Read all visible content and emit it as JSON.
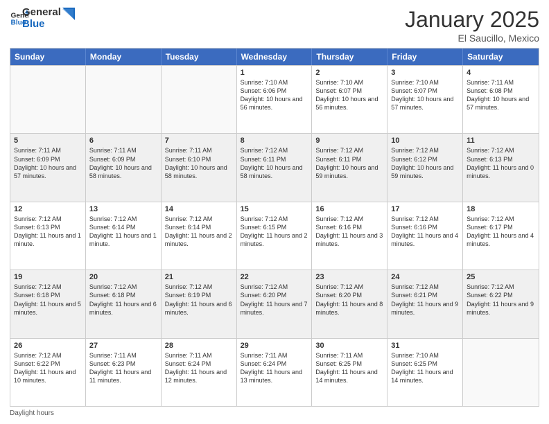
{
  "header": {
    "logo_general": "General",
    "logo_blue": "Blue",
    "month_title": "January 2025",
    "subtitle": "El Saucillo, Mexico"
  },
  "footer": {
    "label": "Daylight hours"
  },
  "days_of_week": [
    "Sunday",
    "Monday",
    "Tuesday",
    "Wednesday",
    "Thursday",
    "Friday",
    "Saturday"
  ],
  "rows": [
    [
      {
        "num": "",
        "info": "",
        "empty": true
      },
      {
        "num": "",
        "info": "",
        "empty": true
      },
      {
        "num": "",
        "info": "",
        "empty": true
      },
      {
        "num": "1",
        "info": "Sunrise: 7:10 AM\nSunset: 6:06 PM\nDaylight: 10 hours and 56 minutes."
      },
      {
        "num": "2",
        "info": "Sunrise: 7:10 AM\nSunset: 6:07 PM\nDaylight: 10 hours and 56 minutes."
      },
      {
        "num": "3",
        "info": "Sunrise: 7:10 AM\nSunset: 6:07 PM\nDaylight: 10 hours and 57 minutes."
      },
      {
        "num": "4",
        "info": "Sunrise: 7:11 AM\nSunset: 6:08 PM\nDaylight: 10 hours and 57 minutes."
      }
    ],
    [
      {
        "num": "5",
        "info": "Sunrise: 7:11 AM\nSunset: 6:09 PM\nDaylight: 10 hours and 57 minutes."
      },
      {
        "num": "6",
        "info": "Sunrise: 7:11 AM\nSunset: 6:09 PM\nDaylight: 10 hours and 58 minutes."
      },
      {
        "num": "7",
        "info": "Sunrise: 7:11 AM\nSunset: 6:10 PM\nDaylight: 10 hours and 58 minutes."
      },
      {
        "num": "8",
        "info": "Sunrise: 7:12 AM\nSunset: 6:11 PM\nDaylight: 10 hours and 58 minutes."
      },
      {
        "num": "9",
        "info": "Sunrise: 7:12 AM\nSunset: 6:11 PM\nDaylight: 10 hours and 59 minutes."
      },
      {
        "num": "10",
        "info": "Sunrise: 7:12 AM\nSunset: 6:12 PM\nDaylight: 10 hours and 59 minutes."
      },
      {
        "num": "11",
        "info": "Sunrise: 7:12 AM\nSunset: 6:13 PM\nDaylight: 11 hours and 0 minutes."
      }
    ],
    [
      {
        "num": "12",
        "info": "Sunrise: 7:12 AM\nSunset: 6:13 PM\nDaylight: 11 hours and 1 minute."
      },
      {
        "num": "13",
        "info": "Sunrise: 7:12 AM\nSunset: 6:14 PM\nDaylight: 11 hours and 1 minute."
      },
      {
        "num": "14",
        "info": "Sunrise: 7:12 AM\nSunset: 6:14 PM\nDaylight: 11 hours and 2 minutes."
      },
      {
        "num": "15",
        "info": "Sunrise: 7:12 AM\nSunset: 6:15 PM\nDaylight: 11 hours and 2 minutes."
      },
      {
        "num": "16",
        "info": "Sunrise: 7:12 AM\nSunset: 6:16 PM\nDaylight: 11 hours and 3 minutes."
      },
      {
        "num": "17",
        "info": "Sunrise: 7:12 AM\nSunset: 6:16 PM\nDaylight: 11 hours and 4 minutes."
      },
      {
        "num": "18",
        "info": "Sunrise: 7:12 AM\nSunset: 6:17 PM\nDaylight: 11 hours and 4 minutes."
      }
    ],
    [
      {
        "num": "19",
        "info": "Sunrise: 7:12 AM\nSunset: 6:18 PM\nDaylight: 11 hours and 5 minutes."
      },
      {
        "num": "20",
        "info": "Sunrise: 7:12 AM\nSunset: 6:18 PM\nDaylight: 11 hours and 6 minutes."
      },
      {
        "num": "21",
        "info": "Sunrise: 7:12 AM\nSunset: 6:19 PM\nDaylight: 11 hours and 6 minutes."
      },
      {
        "num": "22",
        "info": "Sunrise: 7:12 AM\nSunset: 6:20 PM\nDaylight: 11 hours and 7 minutes."
      },
      {
        "num": "23",
        "info": "Sunrise: 7:12 AM\nSunset: 6:20 PM\nDaylight: 11 hours and 8 minutes."
      },
      {
        "num": "24",
        "info": "Sunrise: 7:12 AM\nSunset: 6:21 PM\nDaylight: 11 hours and 9 minutes."
      },
      {
        "num": "25",
        "info": "Sunrise: 7:12 AM\nSunset: 6:22 PM\nDaylight: 11 hours and 9 minutes."
      }
    ],
    [
      {
        "num": "26",
        "info": "Sunrise: 7:12 AM\nSunset: 6:22 PM\nDaylight: 11 hours and 10 minutes."
      },
      {
        "num": "27",
        "info": "Sunrise: 7:11 AM\nSunset: 6:23 PM\nDaylight: 11 hours and 11 minutes."
      },
      {
        "num": "28",
        "info": "Sunrise: 7:11 AM\nSunset: 6:24 PM\nDaylight: 11 hours and 12 minutes."
      },
      {
        "num": "29",
        "info": "Sunrise: 7:11 AM\nSunset: 6:24 PM\nDaylight: 11 hours and 13 minutes."
      },
      {
        "num": "30",
        "info": "Sunrise: 7:11 AM\nSunset: 6:25 PM\nDaylight: 11 hours and 14 minutes."
      },
      {
        "num": "31",
        "info": "Sunrise: 7:10 AM\nSunset: 6:25 PM\nDaylight: 11 hours and 14 minutes."
      },
      {
        "num": "",
        "info": "",
        "empty": true
      }
    ]
  ]
}
